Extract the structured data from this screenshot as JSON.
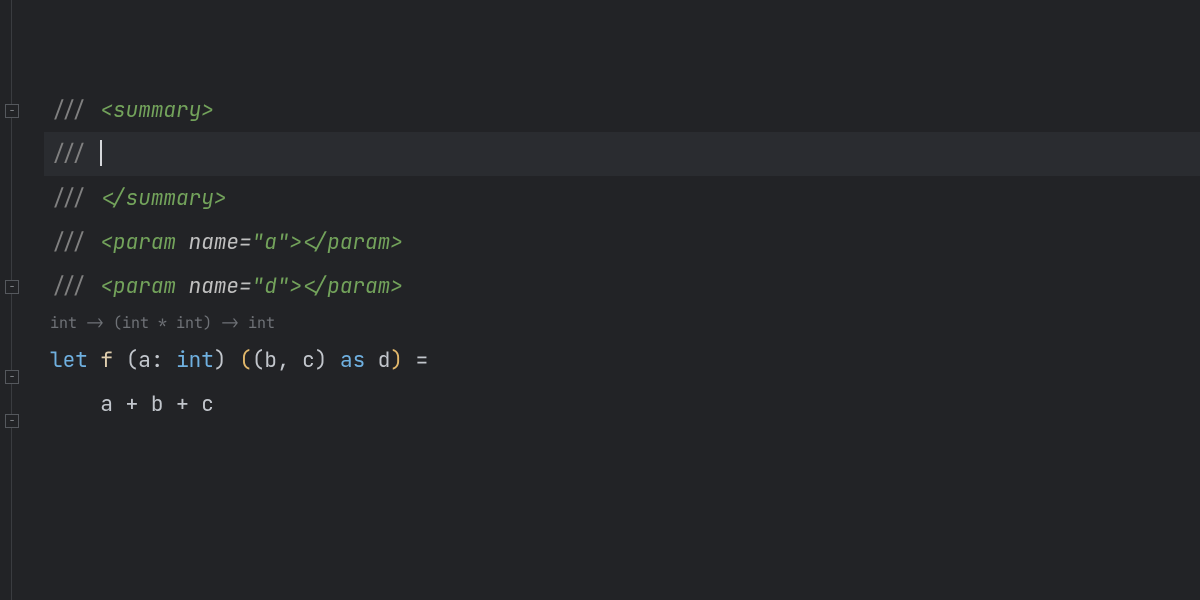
{
  "gutter": {
    "fold_markers_at": [
      104,
      280,
      370,
      414
    ]
  },
  "code": {
    "slash": "///",
    "sp": " ",
    "summary_open": "<summary>",
    "summary_close": "</summary>",
    "param_open": "<param ",
    "param_name_attr": "name",
    "param_eq": "=",
    "param_a_val": "\"a\"",
    "param_d_val": "\"d\"",
    "param_tag_close": ">",
    "param_close": "</param>",
    "hint": "int -> (int * int) -> int",
    "let": "let",
    "fname": "f",
    "lpar": "(",
    "rpar": ")",
    "a": "a",
    "b": "b",
    "c": "c",
    "d": "d",
    "colon": ":",
    "int": "int",
    "comma": ",",
    "as": "as",
    "eq": "=",
    "plus": "+",
    "indent": "    "
  }
}
